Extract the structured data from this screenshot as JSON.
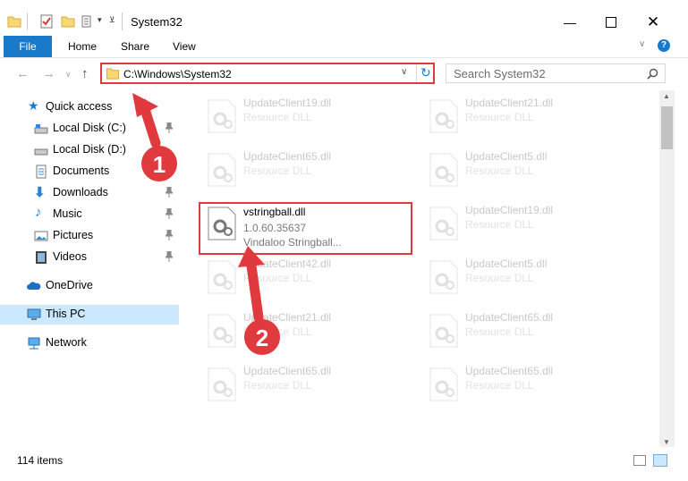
{
  "window": {
    "title": "System32"
  },
  "ribbon": {
    "file": "File",
    "home": "Home",
    "share": "Share",
    "view": "View"
  },
  "address": {
    "path": "C:\\Windows\\System32",
    "search_placeholder": "Search System32"
  },
  "sidebar": {
    "items": [
      {
        "label": "Quick access"
      },
      {
        "label": "Local Disk (C:)"
      },
      {
        "label": "Local Disk (D:)"
      },
      {
        "label": "Documents"
      },
      {
        "label": "Downloads"
      },
      {
        "label": "Music"
      },
      {
        "label": "Pictures"
      },
      {
        "label": "Videos"
      },
      {
        "label": "OneDrive"
      },
      {
        "label": "This PC"
      },
      {
        "label": "Network"
      }
    ]
  },
  "files": {
    "left": [
      {
        "name": "UpdateClient19.dll",
        "sub": "Resource DLL"
      },
      {
        "name": "UpdateClient65.dll",
        "sub": "Resource DLL"
      },
      {
        "name": "vstringball.dll",
        "version": "1.0.60.35637",
        "desc": "Vindaloo Stringball..."
      },
      {
        "name": "UpdateClient42.dll",
        "sub": "Resource DLL"
      },
      {
        "name": "UpdateClient21.dll",
        "sub": "Resource DLL"
      },
      {
        "name": "UpdateClient65.dll",
        "sub": "Resource DLL"
      }
    ],
    "right": [
      {
        "name": "UpdateClient21.dll",
        "sub": "Resource DLL"
      },
      {
        "name": "UpdateClient5.dll",
        "sub": "Resource DLL"
      },
      {
        "name": "UpdateClient19.dll",
        "sub": "Resource DLL"
      },
      {
        "name": "UpdateClient5.dll",
        "sub": "Resource DLL"
      },
      {
        "name": "UpdateClient65.dll",
        "sub": "Resource DLL"
      },
      {
        "name": "UpdateClient65.dll",
        "sub": "Resource DLL"
      }
    ]
  },
  "annotations": {
    "step1": "1",
    "step2": "2"
  },
  "status": {
    "count": "114 items"
  },
  "colors": {
    "highlight": "#e0393e",
    "accent": "#1979ca",
    "selected": "#cce8ff"
  }
}
